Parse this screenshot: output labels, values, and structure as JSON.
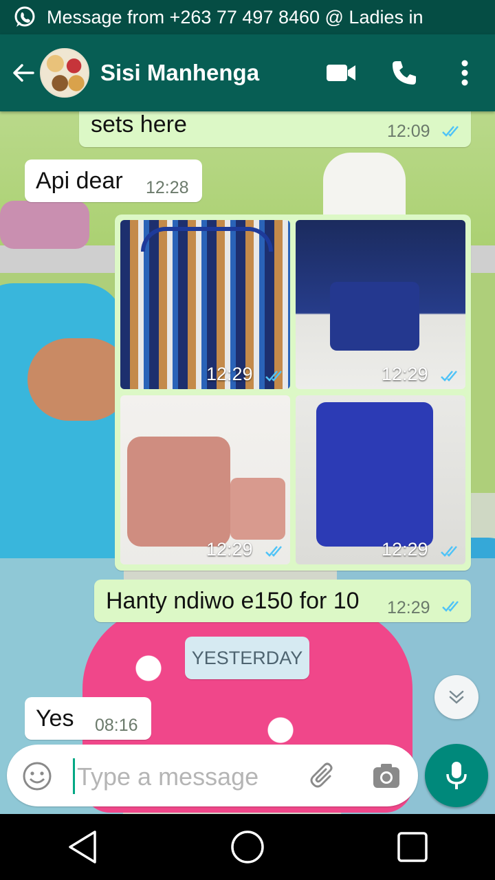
{
  "notification": {
    "text": "Message from +263 77 497 8460 @ Ladies in"
  },
  "header": {
    "contact_name": "Sisi Manhenga",
    "icons": [
      "back-arrow-icon",
      "video-call-icon",
      "phone-call-icon",
      "more-vert-icon"
    ]
  },
  "messages": [
    {
      "direction": "out",
      "text": "sets here",
      "time": "12:09",
      "status": "read"
    },
    {
      "direction": "in",
      "text": "Api dear",
      "time": "12:28"
    },
    {
      "direction": "out",
      "type": "image-album",
      "images": [
        {
          "time": "12:29",
          "status": "read",
          "subject": "striped tote bag set"
        },
        {
          "time": "12:29",
          "status": "read",
          "subject": "navy blue bag set"
        },
        {
          "time": "12:29",
          "status": "read",
          "subject": "pink handbag set"
        },
        {
          "time": "12:29",
          "status": "read",
          "subject": "royal blue bag set"
        }
      ]
    },
    {
      "direction": "out",
      "text": "Hanty ndiwo e150 for 10",
      "time": "12:29",
      "status": "read"
    },
    {
      "type": "date",
      "text": "YESTERDAY"
    },
    {
      "direction": "in",
      "text": "Yes",
      "time": "08:16"
    }
  ],
  "composer": {
    "placeholder": "Type a message"
  },
  "colors": {
    "header": "#075e54",
    "status_bar": "#054d44",
    "outgoing_bubble": "#dcf8c6",
    "incoming_bubble": "#ffffff",
    "read_ticks": "#4fc3f7",
    "fab": "#00897b"
  }
}
